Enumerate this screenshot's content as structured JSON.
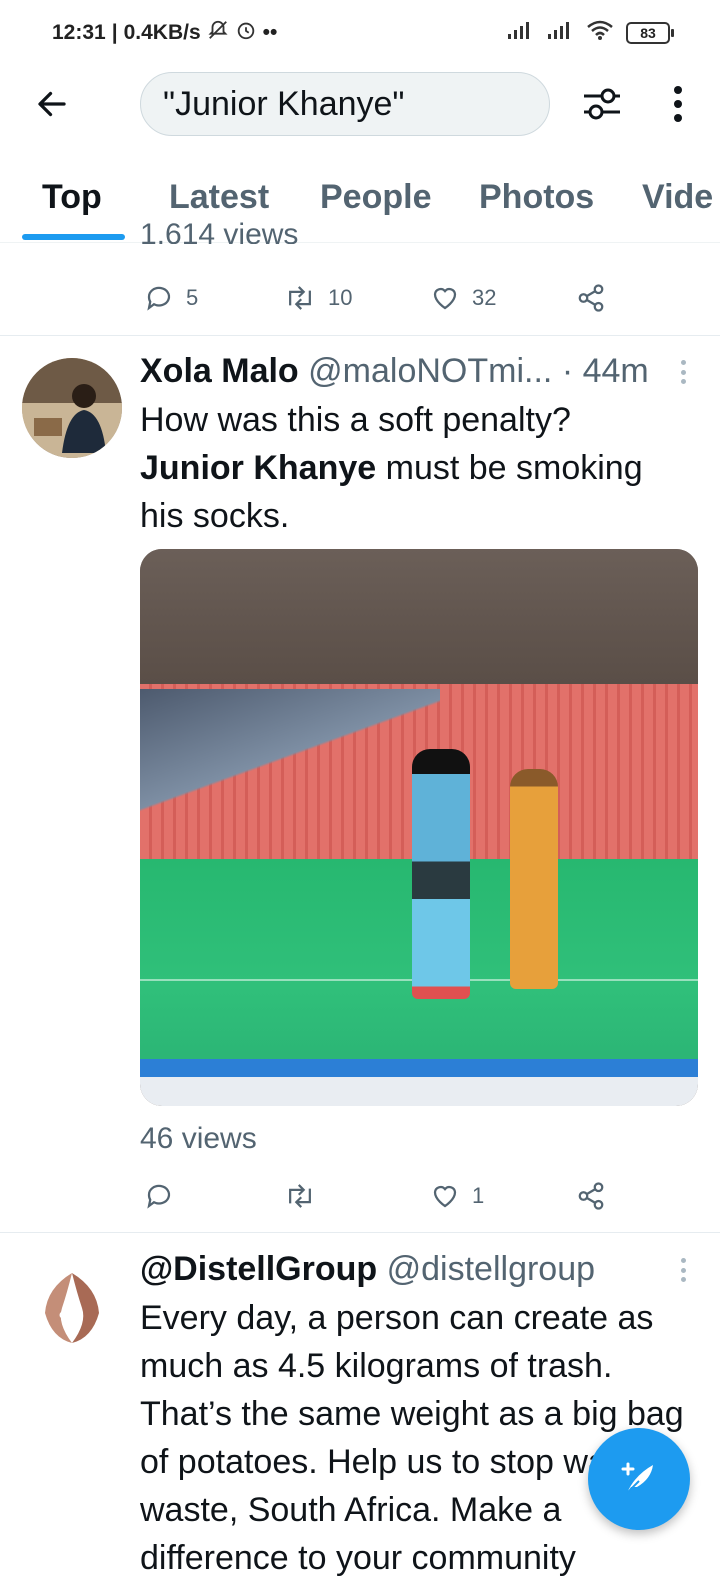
{
  "status_bar": {
    "time": "12:31",
    "speed": "0.4KB/s",
    "battery": "83"
  },
  "search": {
    "query": "\"Junior Khanye\""
  },
  "tabs": [
    {
      "label": "Top"
    },
    {
      "label": "Latest"
    },
    {
      "label": "People"
    },
    {
      "label": "Photos"
    },
    {
      "label": "Vide"
    }
  ],
  "prev_tweet": {
    "views": "1,614 views",
    "replies": "5",
    "retweets": "10",
    "likes": "32"
  },
  "tweet1": {
    "name": "Xola Malo",
    "handle": "@maloNOTmi...",
    "time": "· 44m",
    "text_before": "How was this a soft penalty?",
    "text_bold": "Junior Khanye",
    "text_after": " must be smoking his socks.",
    "views": "46 views",
    "replies": "",
    "retweets": "",
    "likes": "1"
  },
  "tweet2": {
    "name": "@DistellGroup",
    "handle": "@distellgroup",
    "text": "Every day, a person can create as much as 4.5 kilograms of trash. That’s the same weight as a big bag of potatoes. Help us to stop wasting waste, South Africa. Make a difference to your community"
  },
  "colors": {
    "accent": "#1d9bf0",
    "secondary_text": "#536471",
    "primary_text": "#0f1419"
  }
}
